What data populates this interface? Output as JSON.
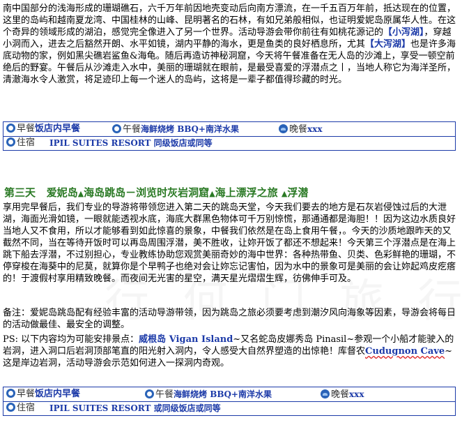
{
  "intro": {
    "p1": "南中国部分的浅海形成的珊瑚礁石，六千万年前因地壳变动后向南方漂流，在一千五百万年前，抵达现在的位置，这里的岛屿和越南夏龙湾、中国桂林的山峰、昆明著名的石林，有如兄弟般相似，也证明爱妮岛原属华人性。在这个奇异的领域形成的湖泊，感觉完全像进入了另一个世界。活动导游会带你前往有如桃花源记的",
    "small_lagoon": "【小泻湖】",
    "p2": "，穿越小洞而入，进去之后豁然开朗、水平如镜，湖内平静的海水，更是鱼类的良好栖息所，尤其",
    "big_lagoon": "【大泻湖】",
    "p3": "也是许多海底动物的家，例如黑尖礁岩鲨鱼&海龟。随后再造访神秘洞窟，今天将午餐准备在无人岛的沙滩上，享受一顿空前绝后的野宴。午餐后从沙滩走入水中，美丽的珊瑚就在眼前，是最受喜爱的浮潜点之丨，当地人称它为海洋圣所，清澈海水令人激赏，将足迹印上每一个迷人的岛屿，这将是一辈子都值得珍藏的时光。"
  },
  "meals1": {
    "breakfast_label": "早餐",
    "breakfast": "饭店内早餐",
    "lunch_label": "午餐",
    "lunch": "海鲜烧烤 BBQ+南洋水果",
    "dinner_label": "晚餐",
    "dinner": "xxx",
    "hotel_label": "住宿",
    "hotel": "IPIL SUITES RESORT 同级饭店或同等"
  },
  "day3": {
    "title_day": "第三天",
    "seg1": "爱妮岛",
    "seg2": "海岛跳岛－浏览时灰岩洞窟",
    "seg3": "海上漂浮之旅",
    "seg4": "浮潜",
    "body": "享用完早餐后，我们专业的导游将带领您进入第二天的跳岛天堂，今天我们要去的地方是石灰岩侵蚀过后的大泄湖，海面光滑如镜，一眼就能透视水底，海底大群黑色物体可千万别惊慌，那通通都是海胆！！因为这边水质良好当地人又不食用，所以才能够看到如此惊喜的景象，中餐我们依然是在岛上食用午餐，。今天的沙质地跟昨天的又截然不同，当在等待开饭时可以再岛周围浮潜，美不胜收，让妳开饭了都还不想起来！今天第三个浮潜点是在海上跳下船去浮潜，不过别担心，专业教练协助您观赏美丽奇妙的海中世界：各种热带鱼、贝类、色彩鲜艳的珊瑚，不停穿梭在海葵中的尼莫，就算你是个早鸭子也绝对会让妳忘记害怕，因为水中的景象可是美丽的会让妳起鸡皮疙瘩的！于渡假村享用精致晚餐。而夜间无光害的星空，满天星光熠熠生辉，彷佛伸手可及。",
    "note": "备注：爱妮岛跳岛配有经验丰富的活动导游带领，因为跳岛之旅必须要考虑到潮汐风向海象等因素，导游会将每日的活动做最佳、最安全的调整。",
    "ps_prefix": "PS: 以下内容均为可能安排景点：",
    "vigan": "威根岛 Vigan Island",
    "ps_mid1": "~又名蛇岛皮娜秀岛 Pinasil~参观一个小船才能驶入的岩洞，进入洞口后岩洞顶部笔直的阳光射入洞内，令人感受大自然界塑造的出惊艳！库督农",
    "cudugnon": "Cudugnon Cave",
    "ps_end": "~这是岸边岩洞，活动导游会示范如何进入一探洞内奇观。"
  },
  "meals2": {
    "breakfast_label": "早餐",
    "breakfast": "饭店内早餐",
    "lunch_label": "午餐",
    "lunch": "海鲜烧烤 BBQ+南洋水果",
    "dinner_label": "晚餐",
    "dinner": "xxx",
    "hotel_label": "住宿",
    "hotel": "IPIL SUITES RESORT 或同级饭店或同等"
  }
}
